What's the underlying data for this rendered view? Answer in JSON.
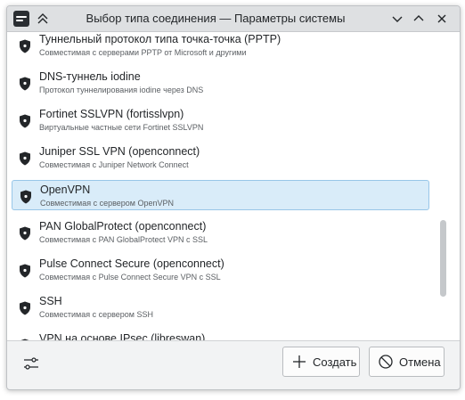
{
  "window": {
    "title": "Выбор типа соединения — Параметры системы"
  },
  "connections": [
    {
      "name": "Туннельный протокол типа точка-точка (PPTP)",
      "description": "Совместимая с серверами PPTP от Microsoft и другими",
      "icon": "shield-icon"
    },
    {
      "name": "DNS-туннель iodine",
      "description": "Протокол туннелирования iodine через DNS",
      "icon": "shield-icon"
    },
    {
      "name": "Fortinet SSLVPN (fortisslvpn)",
      "description": "Виртуальные частные сети Fortinet SSLVPN",
      "icon": "shield-icon"
    },
    {
      "name": "Juniper SSL VPN (openconnect)",
      "description": "Совместимая с Juniper Network Connect",
      "icon": "shield-icon"
    },
    {
      "name": "OpenVPN",
      "description": "Совместимая с сервером OpenVPN",
      "icon": "shield-icon",
      "selected": true
    },
    {
      "name": "PAN GlobalProtect (openconnect)",
      "description": "Совместимая с PAN GlobalProtect VPN с SSL",
      "icon": "shield-icon"
    },
    {
      "name": "Pulse Connect Secure (openconnect)",
      "description": "Совместимая с Pulse Connect Secure VPN с SSL",
      "icon": "shield-icon"
    },
    {
      "name": "SSH",
      "description": "Совместимая с сервером SSH",
      "icon": "shield-icon"
    },
    {
      "name": "VPN на основе IPsec (libreswan)",
      "description": "",
      "icon": "shield-icon"
    }
  ],
  "footer": {
    "create_label": "Создать",
    "cancel_label": "Отмена"
  },
  "colors": {
    "selection_bg": "#d9ecf9",
    "selection_border": "#98c6e8",
    "titlebar_bg": "#dee0e2",
    "window_bg": "#f2f3f4"
  }
}
